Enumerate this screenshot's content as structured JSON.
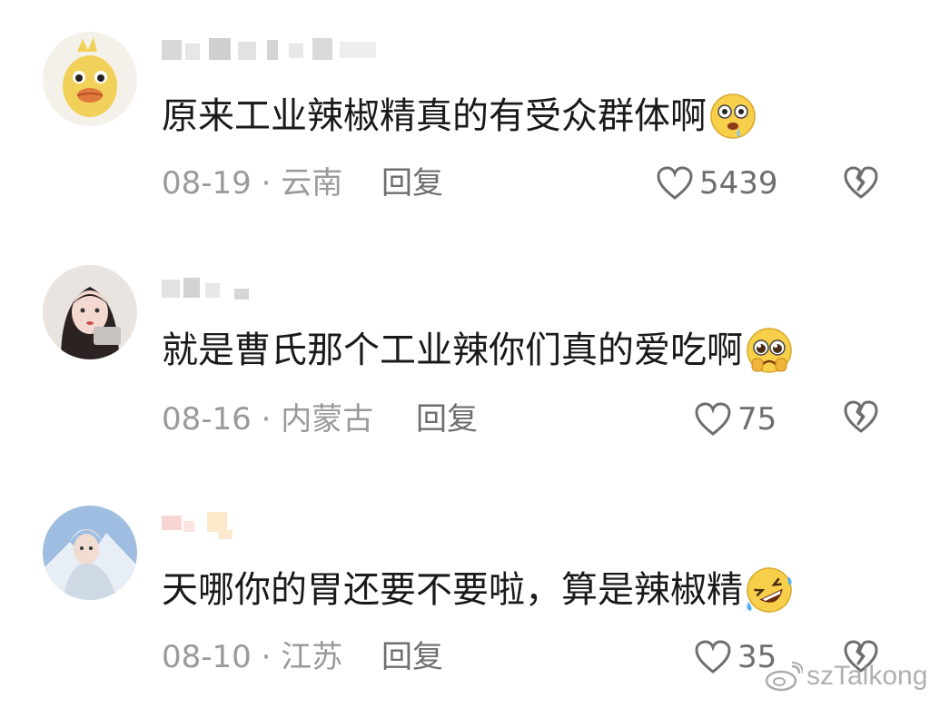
{
  "comments": [
    {
      "text": "原来工业辣椒精真的有受众群体啊",
      "date": "08-19",
      "location": "云南",
      "reply": "回复",
      "likes": "5439",
      "emoji": "drooling-face-emoji",
      "avatar": "yellow-chick-avatar"
    },
    {
      "text": "就是曹氏那个工业辣你们真的爱吃啊",
      "date": "08-16",
      "location": "内蒙古",
      "reply": "回复",
      "likes": "75",
      "emoji": "pleading-face-emoji",
      "avatar": "girl-photo-avatar"
    },
    {
      "text": "天哪你的胃还要不要啦，算是辣椒精",
      "date": "08-10",
      "location": "江苏",
      "reply": "回复",
      "likes": "35",
      "emoji": "rolling-laughing-emoji",
      "avatar": "snow-costume-avatar"
    }
  ],
  "meta_separator": "·",
  "watermark": "szTalkong",
  "colors": {
    "text": "#1a1a1a",
    "meta": "#9a9a9a",
    "icon": "#6e6e6e"
  }
}
